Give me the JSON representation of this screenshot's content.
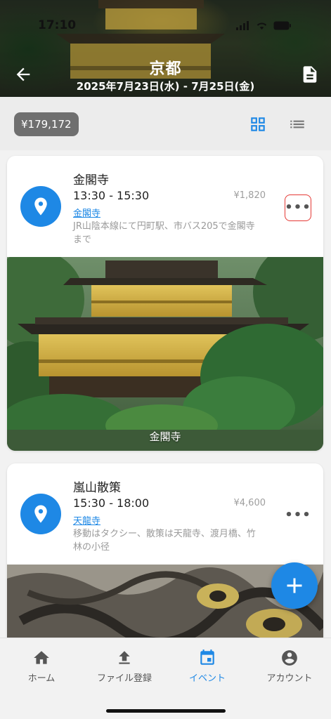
{
  "status_bar": {
    "time": "17:10"
  },
  "header": {
    "title": "京都",
    "dates": "2025年7月23日(水) - 7月25日(金)"
  },
  "toolbar": {
    "budget": "¥179,172"
  },
  "events": [
    {
      "title": "金閣寺",
      "time": "13:30 - 15:30",
      "price": "¥1,820",
      "link": "金閣寺",
      "note": "JR山陰本線にて円町駅、市バス205で金閣寺まで",
      "photo_caption": "金閣寺"
    },
    {
      "title": "嵐山散策",
      "time": "15:30 - 18:00",
      "price": "¥4,600",
      "link": "天龍寺",
      "note": "移動はタクシー、散策は天龍寺、渡月橋、竹林の小径"
    }
  ],
  "nav": [
    {
      "label": "ホーム",
      "icon": "home-icon"
    },
    {
      "label": "ファイル登録",
      "icon": "upload-icon"
    },
    {
      "label": "イベント",
      "icon": "calendar-icon",
      "active": true
    },
    {
      "label": "アカウント",
      "icon": "account-icon"
    }
  ],
  "colors": {
    "accent": "#1e88e5",
    "chip": "#6f6f6f",
    "focus_outline": "#e53935"
  }
}
